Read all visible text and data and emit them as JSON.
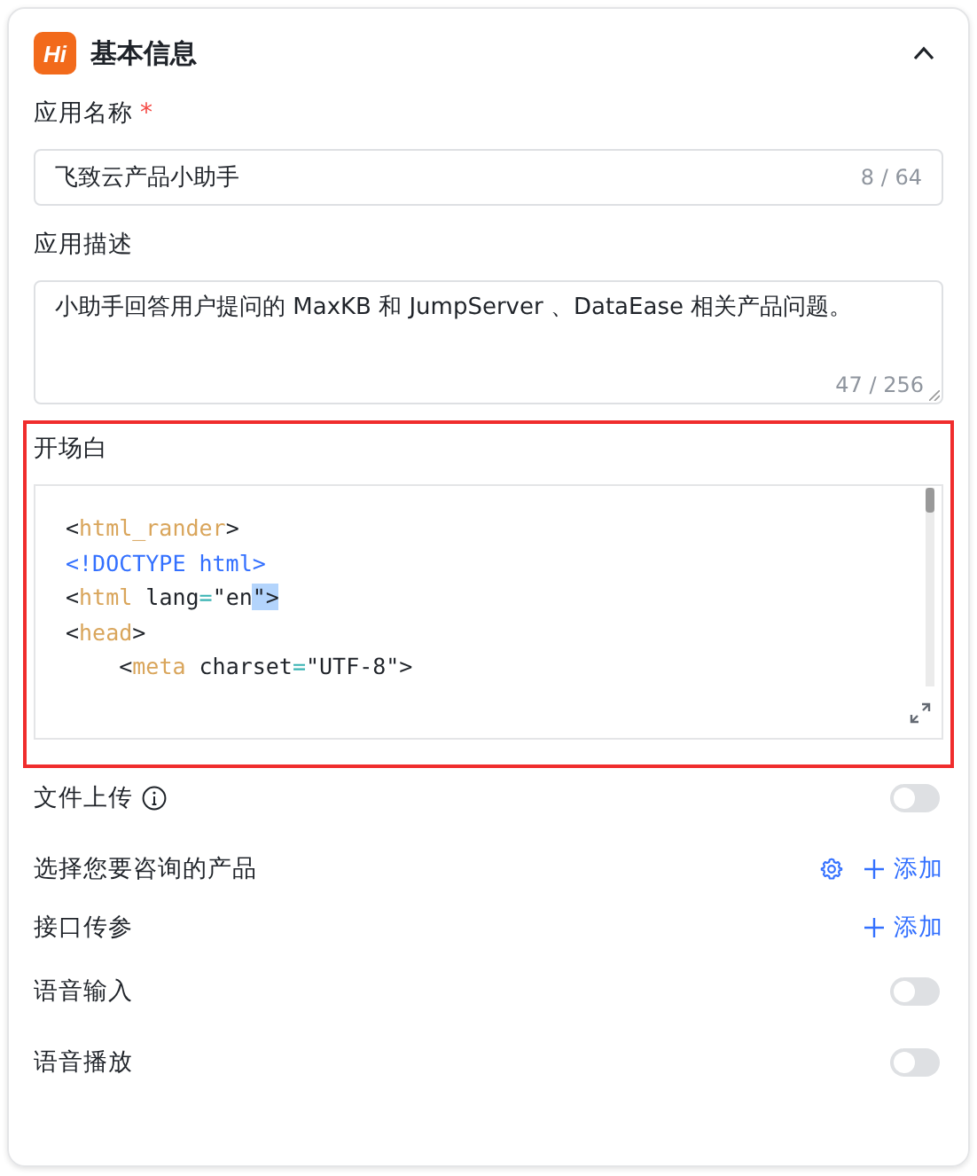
{
  "panel": {
    "logo": "Hi",
    "title": "基本信息",
    "expanded": true
  },
  "name_field": {
    "label": "应用名称",
    "required_mark": "*",
    "value": "飞致云产品小助手",
    "count": "8 / 64"
  },
  "description_field": {
    "label": "应用描述",
    "value": "小助手回答用户提问的 MaxKB 和 JumpServer 、DataEase 相关产品问题。",
    "count": "47 / 256"
  },
  "opening": {
    "label": "开场白",
    "highlighted": true,
    "code_lines": [
      {
        "tokens": [
          {
            "text": "<",
            "kind": "punct",
            "selected": false
          },
          {
            "text": "html_rander",
            "kind": "tag",
            "selected": false
          },
          {
            "text": ">",
            "kind": "punct",
            "selected": false
          }
        ]
      },
      {
        "tokens": [
          {
            "text": "<!DOCTYPE html>",
            "kind": "doctype",
            "selected": false
          }
        ]
      },
      {
        "tokens": [
          {
            "text": "<",
            "kind": "punct",
            "selected": false
          },
          {
            "text": "html",
            "kind": "tag",
            "selected": false
          },
          {
            "text": " lang",
            "kind": "attr",
            "selected": false
          },
          {
            "text": "=",
            "kind": "eq",
            "selected": false
          },
          {
            "text": "\"en",
            "kind": "string",
            "selected": false
          },
          {
            "text": "\">",
            "kind": "string",
            "selected": true
          }
        ]
      },
      {
        "tokens": [
          {
            "text": "<",
            "kind": "punct",
            "selected": false
          },
          {
            "text": "head",
            "kind": "tag",
            "selected": false
          },
          {
            "text": ">",
            "kind": "punct",
            "selected": false
          }
        ]
      },
      {
        "tokens": [
          {
            "text": "    <",
            "kind": "punct",
            "selected": false
          },
          {
            "text": "meta",
            "kind": "tag",
            "selected": false
          },
          {
            "text": " charset",
            "kind": "attr",
            "selected": false
          },
          {
            "text": "=",
            "kind": "eq",
            "selected": false
          },
          {
            "text": "\"UTF-8\">",
            "kind": "string",
            "selected": false
          }
        ]
      }
    ]
  },
  "settings": [
    {
      "kind": "switch",
      "label": "文件上传",
      "info": true,
      "on": false
    },
    {
      "kind": "add",
      "label": "选择您要咨询的产品",
      "gear": true,
      "action": "添加"
    },
    {
      "kind": "add",
      "label": "接口传参",
      "gear": false,
      "action": "添加"
    },
    {
      "kind": "switch",
      "label": "语音输入",
      "info": false,
      "on": false
    },
    {
      "kind": "switch",
      "label": "语音播放",
      "info": false,
      "on": false
    }
  ]
}
